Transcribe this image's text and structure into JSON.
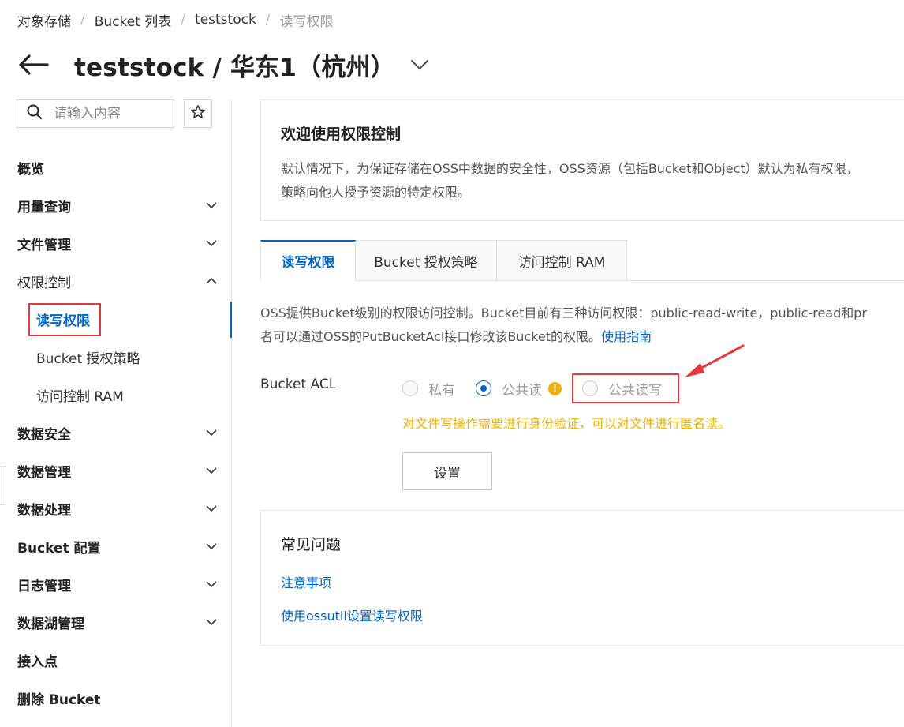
{
  "breadcrumb": {
    "items": [
      "对象存储",
      "Bucket 列表",
      "teststock",
      "读写权限"
    ],
    "separator": "/"
  },
  "header": {
    "title": "teststock / 华东1（杭州）",
    "back_icon": "arrow-left-icon",
    "dropdown_icon": "chevron-down-icon"
  },
  "sidebar": {
    "search_placeholder": "请输入内容",
    "items": [
      {
        "label": "概览",
        "bold": true,
        "chevron": null
      },
      {
        "label": "用量查询",
        "bold": true,
        "chevron": "down"
      },
      {
        "label": "文件管理",
        "bold": true,
        "chevron": "down"
      },
      {
        "label": "权限控制",
        "bold": false,
        "chevron": "up"
      },
      {
        "label": "读写权限",
        "sub": true,
        "active": true
      },
      {
        "label": "Bucket 授权策略",
        "sub": true
      },
      {
        "label": "访问控制 RAM",
        "sub": true
      },
      {
        "label": "数据安全",
        "bold": true,
        "chevron": "down"
      },
      {
        "label": "数据管理",
        "bold": true,
        "chevron": "down"
      },
      {
        "label": "数据处理",
        "bold": true,
        "chevron": "down"
      },
      {
        "label": "Bucket 配置",
        "bold": true,
        "chevron": "down"
      },
      {
        "label": "日志管理",
        "bold": true,
        "chevron": "down"
      },
      {
        "label": "数据湖管理",
        "bold": true,
        "chevron": "down"
      },
      {
        "label": "接入点",
        "bold": true,
        "chevron": null
      },
      {
        "label": "删除 Bucket",
        "bold": true,
        "chevron": null
      }
    ]
  },
  "welcome": {
    "title": "欢迎使用权限控制",
    "line1": "默认情况下，为保证存储在OSS中数据的安全性，OSS资源（包括Bucket和Object）默认为私有权限，",
    "line2": "策略向他人授予资源的特定权限。"
  },
  "tabs": [
    "读写权限",
    "Bucket 授权策略",
    "访问控制 RAM"
  ],
  "description": {
    "line1": "OSS提供Bucket级别的权限访问控制。Bucket目前有三种访问权限：public-read-write，public-read和pr",
    "line2": "者可以通过OSS的PutBucketAcl接口修改该Bucket的权限。",
    "link": "使用指南"
  },
  "acl": {
    "label": "Bucket ACL",
    "options": [
      "私有",
      "公共读",
      "公共读写"
    ],
    "selected": "公共读",
    "hint": "对文件写操作需要进行身份验证，可以对文件进行匿名读。",
    "warn_symbol": "!",
    "set_button": "设置"
  },
  "faq": {
    "title": "常见问题",
    "links": [
      "注意事项",
      "使用ossutil设置读写权限"
    ]
  },
  "colors": {
    "accent": "#0064c8",
    "highlight": "#e8383d",
    "warning": "#f2b100"
  }
}
